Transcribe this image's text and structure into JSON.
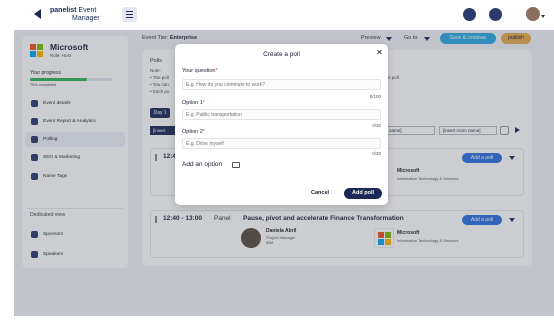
{
  "header": {
    "brand": "panelist",
    "product_line1": "Event",
    "product_line2": "Manager"
  },
  "sidebar": {
    "org_name": "Microsoft",
    "role": "Role: Host",
    "progress_label": "Your progress",
    "progress_value": 0.7,
    "progress_text": "70% completed",
    "items": [
      {
        "label": "Event details",
        "icon": "document-icon"
      },
      {
        "label": "Event Report & Analytics",
        "icon": "analytics-icon"
      },
      {
        "label": "Polling",
        "icon": "poll-icon"
      },
      {
        "label": "SEO & Marketing",
        "icon": "marketing-icon"
      },
      {
        "label": "Name Tags",
        "icon": "tag-icon"
      }
    ],
    "dedicated_label": "Dedicated view",
    "dedicated_items": [
      {
        "label": "Sponsors",
        "icon": "sponsor-icon"
      },
      {
        "label": "Speakers",
        "icon": "speaker-icon"
      }
    ]
  },
  "toolbar": {
    "tier_label": "Event Tier: ",
    "tier_value": "Enterprise",
    "preview": "Preview",
    "goto": "Go to",
    "save_continue": "Save & continue",
    "publish": "publish"
  },
  "polls": {
    "heading": "Polls",
    "note_label": "Note:",
    "note_lines": [
      "• The poll",
      "• You can",
      "• Each po"
    ],
    "note_right": "e poll.",
    "day": "Day 1",
    "insert_left": "[insert",
    "insert_room_prefix": "name]",
    "insert_room": "[insert room name]"
  },
  "sessions": [
    {
      "time": "12:40",
      "kind": "",
      "title": "",
      "speaker_name": "",
      "speaker_role": "",
      "speaker_company": "",
      "sponsor_name": "Microsoft",
      "sponsor_category": "Information Technology & Services",
      "add_poll": "Add a poll"
    },
    {
      "time": "12:40 - 13:00",
      "kind": "Panel",
      "title": "Pause, pivot and accelerate Finance Transformation",
      "speaker_name": "Daniela Abril",
      "speaker_role": "Project Manager",
      "speaker_company": "IBM",
      "sponsor_name": "Microsoft",
      "sponsor_category": "Information Technology & Services",
      "add_poll": "Add a poll"
    }
  ],
  "modal": {
    "title": "Create a poll",
    "question_label": "Your question",
    "question_placeholder": "E.g. How do you commute to work?",
    "question_count": "0/100",
    "option1_label": "Option 1",
    "option1_placeholder": "E.g. Public transportation",
    "option1_count": "0/30",
    "option2_label": "Option 2",
    "option2_placeholder": "E.g. Drive myself",
    "option2_count": "0/30",
    "add_option": "Add an option",
    "cancel": "Cancel",
    "add_poll": "Add poll",
    "required_mark": "*"
  },
  "colors": {
    "navy": "#1b2a55",
    "accent_blue": "#2ba8e0",
    "publish_orange": "#e5a94a",
    "progress_green": "#2fb356"
  }
}
